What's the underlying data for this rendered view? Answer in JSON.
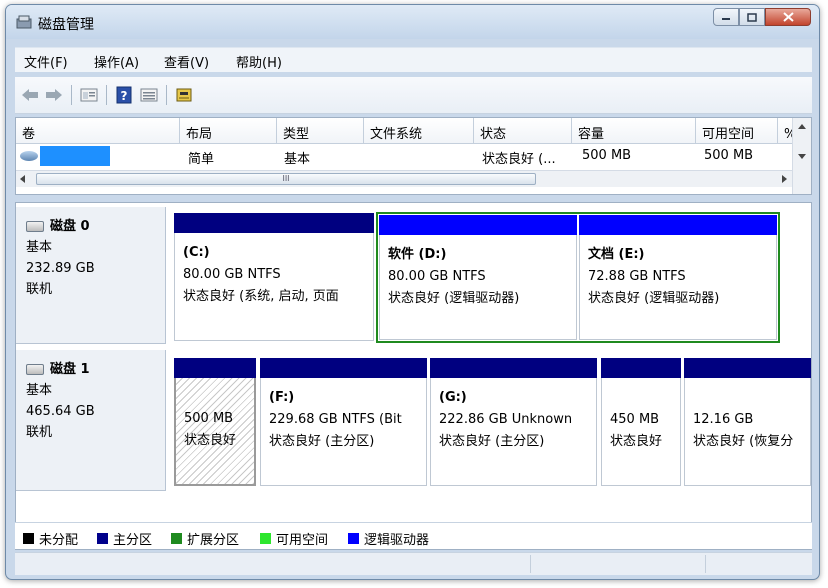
{
  "window": {
    "title": "磁盘管理"
  },
  "menu": [
    "文件(F)",
    "操作(A)",
    "查看(V)",
    "帮助(H)"
  ],
  "toolbar": [
    "back-icon",
    "forward-icon",
    "properties-icon",
    "help-icon",
    "view-icon",
    "disk-wizard-icon"
  ],
  "volume_list": {
    "columns": [
      "卷",
      "布局",
      "类型",
      "文件系统",
      "状态",
      "容量",
      "可用空间",
      "% 可"
    ],
    "row": {
      "volume": "",
      "layout": "简单",
      "type": "基本",
      "fs": "",
      "status": "状态良好 (...",
      "capacity": "500 MB",
      "free": "500 MB"
    },
    "scroll_grip": "III"
  },
  "disks": [
    {
      "name": "磁盘 0",
      "type": "基本",
      "size": "232.89 GB",
      "state": "联机",
      "partitions": [
        {
          "name": "(C:)",
          "size": "80.00 GB NTFS",
          "status": "状态良好 (系统, 启动, 页面"
        },
        {
          "name": "软件  (D:)",
          "size": "80.00 GB NTFS",
          "status": "状态良好 (逻辑驱动器)"
        },
        {
          "name": "文档  (E:)",
          "size": "72.88 GB NTFS",
          "status": "状态良好 (逻辑驱动器)"
        }
      ]
    },
    {
      "name": "磁盘 1",
      "type": "基本",
      "size": "465.64 GB",
      "state": "联机",
      "partitions": [
        {
          "name": "",
          "size": "500 MB",
          "status": "状态良好"
        },
        {
          "name": "(F:)",
          "size": "229.68 GB NTFS (Bit",
          "status": "状态良好 (主分区)"
        },
        {
          "name": "(G:)",
          "size": "222.86 GB Unknown",
          "status": "状态良好 (主分区)"
        },
        {
          "name": "",
          "size": "450 MB",
          "status": "状态良好"
        },
        {
          "name": "",
          "size": "12.16 GB",
          "status": "状态良好 (恢复分"
        }
      ]
    }
  ],
  "legend": [
    {
      "label": "未分配",
      "color": "#000000"
    },
    {
      "label": "主分区",
      "color": "#00008b"
    },
    {
      "label": "扩展分区",
      "color": "#1f8a1f"
    },
    {
      "label": "可用空间",
      "color": "#2ee62e"
    },
    {
      "label": "逻辑驱动器",
      "color": "#0000ff"
    }
  ],
  "colors": {
    "primary": "#000080",
    "logical": "#0000ff",
    "extended": "#1f8a1f",
    "volume_highlight": "#1e90ff"
  }
}
